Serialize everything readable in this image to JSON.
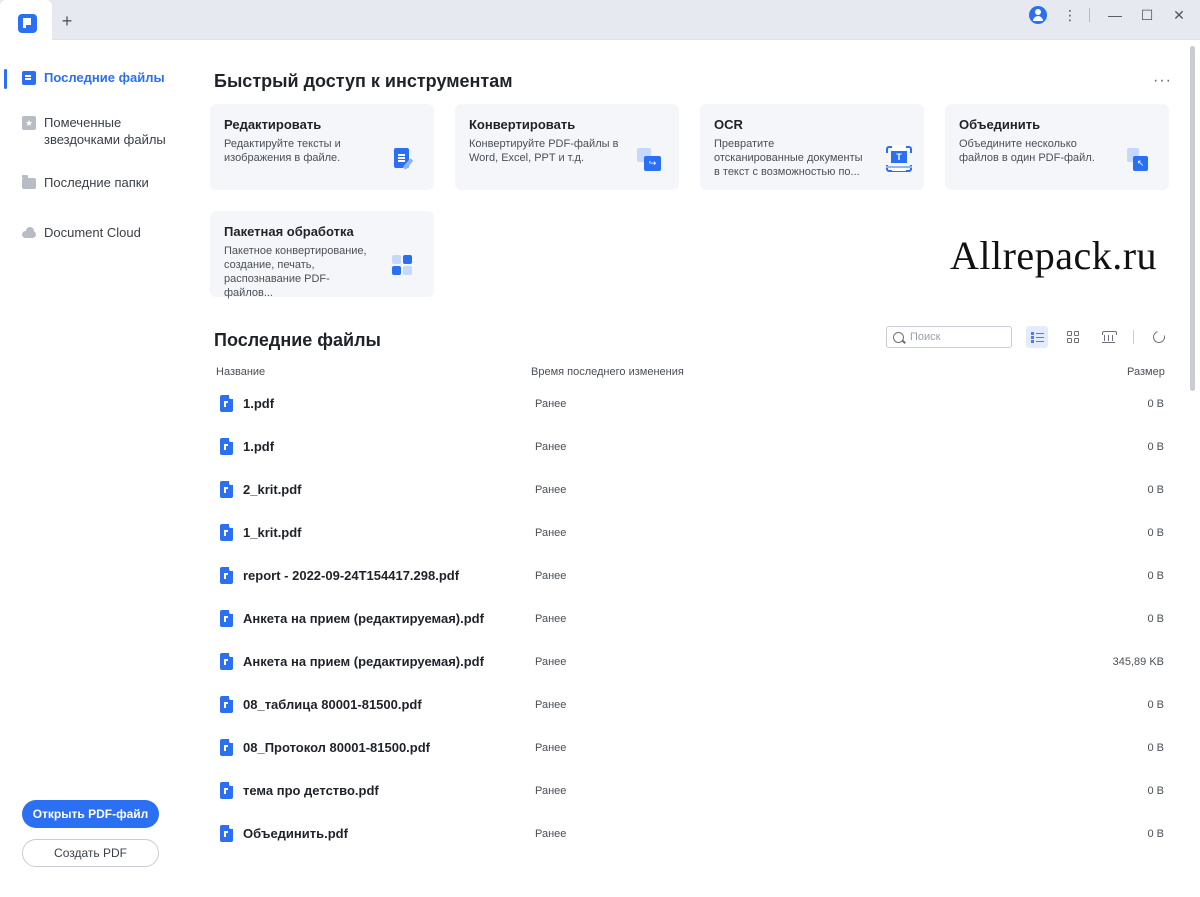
{
  "titlebar": {
    "new_tab_label": "+",
    "more_label": "⋮",
    "minimize_label": "—",
    "maximize_label": "☐",
    "close_label": "✕"
  },
  "sidebar": {
    "items": [
      {
        "label": "Последние файлы",
        "icon": "document-icon"
      },
      {
        "label": "Помеченные звездочками файлы",
        "icon": "star-icon"
      },
      {
        "label": "Последние папки",
        "icon": "folder-icon"
      },
      {
        "label": "Document Cloud",
        "icon": "cloud-icon"
      }
    ],
    "open_button": "Открыть PDF-файл",
    "create_button": "Создать PDF"
  },
  "quick_access": {
    "title": "Быстрый доступ к инструментам",
    "more": "···",
    "cards": [
      {
        "title": "Редактировать",
        "desc": "Редактируйте тексты и изображения в файле.",
        "icon": "edit-icon"
      },
      {
        "title": "Конвертировать",
        "desc": "Конвертируйте PDF-файлы в Word, Excel, PPT и т.д.",
        "icon": "convert-icon"
      },
      {
        "title": "OCR",
        "desc": "Превратите отсканированные документы в текст с возможностью по...",
        "icon": "ocr-icon"
      },
      {
        "title": "Объединить",
        "desc": "Объедините несколько файлов в один PDF-файл.",
        "icon": "merge-icon"
      },
      {
        "title": "Пакетная обработка",
        "desc": "Пакетное конвертирование, создание, печать, распознавание PDF-файлов...",
        "icon": "batch-icon"
      }
    ]
  },
  "watermark": "Allrepack.ru",
  "recent": {
    "title": "Последние файлы",
    "search_placeholder": "Поиск",
    "columns": {
      "name": "Название",
      "time": "Время последнего изменения",
      "size": "Размер"
    },
    "files": [
      {
        "name": "1.pdf",
        "time": "Ранее",
        "size": "0 B"
      },
      {
        "name": "1.pdf",
        "time": "Ранее",
        "size": "0 B"
      },
      {
        "name": "2_krit.pdf",
        "time": "Ранее",
        "size": "0 B"
      },
      {
        "name": "1_krit.pdf",
        "time": "Ранее",
        "size": "0 B"
      },
      {
        "name": "report - 2022-09-24T154417.298.pdf",
        "time": "Ранее",
        "size": "0 B"
      },
      {
        "name": "Анкета на прием (редактируемая).pdf",
        "time": "Ранее",
        "size": "0 B"
      },
      {
        "name": "Анкета на прием (редактируемая).pdf",
        "time": "Ранее",
        "size": "345,89 KB"
      },
      {
        "name": "08_таблица 80001-81500.pdf",
        "time": "Ранее",
        "size": "0 B"
      },
      {
        "name": "08_Протокол 80001-81500.pdf",
        "time": "Ранее",
        "size": "0 B"
      },
      {
        "name": "тема про детство.pdf",
        "time": "Ранее",
        "size": "0 B"
      },
      {
        "name": "Объединить.pdf",
        "time": "Ранее",
        "size": "0 B"
      }
    ]
  },
  "colors": {
    "accent": "#2b6ff3",
    "card_bg": "#f5f6f9",
    "window_bg": "#e9ecf2"
  }
}
